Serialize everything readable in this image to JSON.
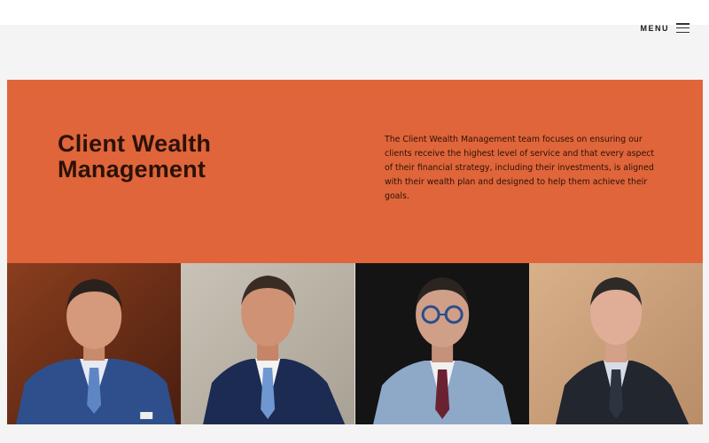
{
  "header": {
    "menu_label": "MENU"
  },
  "hero": {
    "title": "Client Wealth Management",
    "description": "The Client Wealth Management team focuses on ensuring our clients receive the highest level of service and that every aspect of their financial strategy, including their investments, is aligned with their wealth plan and designed to help them achieve their goals.",
    "background_color": "#e0653a"
  },
  "team": {
    "photos": [
      "portrait-1",
      "portrait-2",
      "portrait-3",
      "portrait-4"
    ]
  }
}
